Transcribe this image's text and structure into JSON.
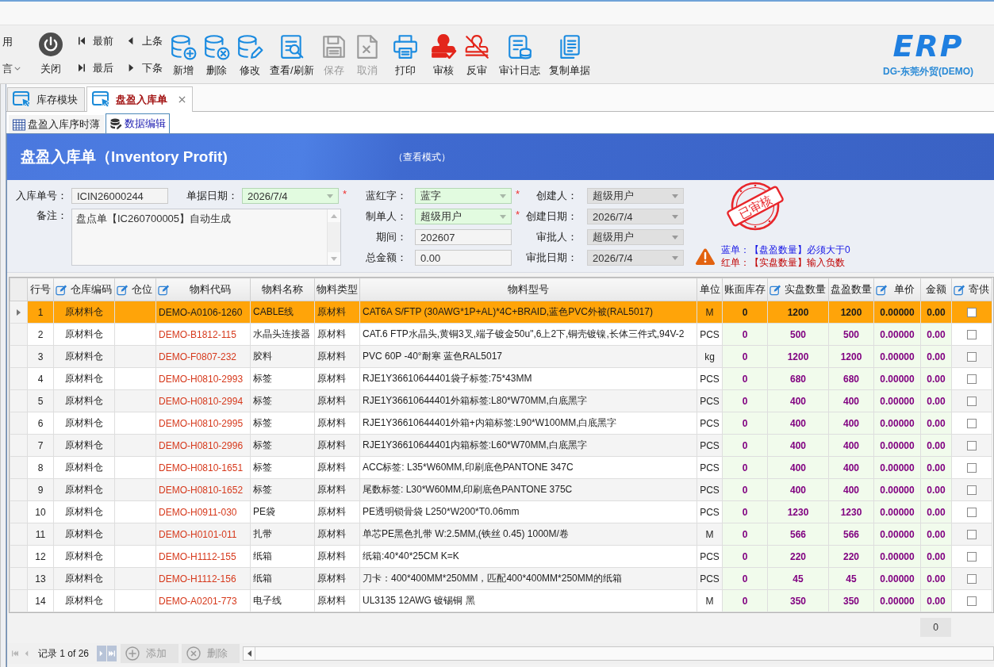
{
  "toolbar": {
    "quick": [
      {
        "label": "用",
        "dropdown": false
      },
      {
        "label": "言",
        "dropdown": true
      }
    ],
    "close": {
      "label": "关闭"
    },
    "nav": [
      {
        "label": "最前",
        "kind": "first"
      },
      {
        "label": "上条",
        "kind": "prev"
      },
      {
        "label": "最后",
        "kind": "last"
      },
      {
        "label": "下条",
        "kind": "next"
      }
    ],
    "actions": [
      {
        "label": "新增",
        "kind": "add",
        "disabled": false
      },
      {
        "label": "删除",
        "kind": "delete",
        "disabled": false
      },
      {
        "label": "修改",
        "kind": "edit",
        "disabled": false
      },
      {
        "label": "查看/刷新",
        "kind": "view",
        "disabled": false
      },
      {
        "label": "保存",
        "kind": "save",
        "disabled": true
      },
      {
        "label": "取消",
        "kind": "cancel",
        "disabled": true
      },
      {
        "label": "打印",
        "kind": "print",
        "disabled": false
      },
      {
        "label": "审核",
        "kind": "approve",
        "disabled": false
      },
      {
        "label": "反审",
        "kind": "unapprove",
        "disabled": false
      },
      {
        "label": "审计日志",
        "kind": "audit",
        "disabled": false
      },
      {
        "label": "复制单据",
        "kind": "copy",
        "disabled": false
      }
    ]
  },
  "logo": {
    "text": "ERP",
    "caption": "DG-东莞外贸(DEMO)"
  },
  "tabs": [
    {
      "label": "库存模块",
      "selected": false,
      "closable": false
    },
    {
      "label": "盘盈入库单",
      "selected": true,
      "closable": true
    }
  ],
  "subtabs": [
    {
      "label": "盘盈入库序时薄",
      "kind": "grid",
      "selected": false
    },
    {
      "label": "数据编辑",
      "kind": "database",
      "selected": true
    }
  ],
  "header": {
    "title": "盘盈入库单（Inventory Profit)",
    "mode": "（查看模式）"
  },
  "form": {
    "head": [
      {
        "label": "入库单号：",
        "value": "ICIN26000244",
        "kind": "text",
        "editable": false,
        "disabled": false
      },
      {
        "label": "单据日期：",
        "value": "2026/7/4",
        "kind": "select",
        "editable": true,
        "disabled": false,
        "mark": "*"
      }
    ],
    "memo": {
      "label": "备注：",
      "value": "盘点单【IC260700005】自动生成"
    },
    "middle": [
      {
        "label": "蓝红字：",
        "value": "蓝字",
        "kind": "select",
        "editable": true,
        "disabled": false,
        "mark": "*"
      },
      {
        "label": "制单人：",
        "value": "超级用户",
        "kind": "select",
        "editable": true,
        "disabled": false,
        "mark": "*"
      },
      {
        "label": "期间：",
        "value": "202607",
        "kind": "text",
        "editable": false,
        "disabled": false
      },
      {
        "label": "总金额：",
        "value": "0.00",
        "kind": "text",
        "editable": false,
        "disabled": false
      }
    ],
    "right": [
      {
        "label": "创建人：",
        "value": "超级用户",
        "kind": "select",
        "editable": false,
        "disabled": true
      },
      {
        "label": "创建日期：",
        "value": "2026/7/4",
        "kind": "select",
        "editable": false,
        "disabled": true
      },
      {
        "label": "审批人：",
        "value": "超级用户",
        "kind": "select",
        "editable": false,
        "disabled": true
      },
      {
        "label": "审批日期：",
        "value": "2026/7/4",
        "kind": "select",
        "editable": false,
        "disabled": true
      }
    ]
  },
  "stamp": {
    "text": "已审核"
  },
  "notes": [
    {
      "text": "蓝单：【盘盈数量】必须大于0",
      "color": "#1414e6"
    },
    {
      "text": "红单：【实盘数量】输入负数",
      "color": "#c00000"
    }
  ],
  "table": {
    "columns": [
      {
        "label": "行号",
        "kind": "index",
        "editable": false
      },
      {
        "label": "仓库编码",
        "kind": "center",
        "editable": true
      },
      {
        "label": "仓位",
        "kind": "center",
        "editable": true
      },
      {
        "label": "物料代码",
        "kind": "code",
        "editable": true
      },
      {
        "label": "物料名称",
        "kind": "text",
        "editable": false
      },
      {
        "label": "物料类型",
        "kind": "text",
        "editable": false
      },
      {
        "label": "物料型号",
        "kind": "text",
        "editable": false
      },
      {
        "label": "单位",
        "kind": "center",
        "editable": false
      },
      {
        "label": "账面库存",
        "kind": "number",
        "editable": false
      },
      {
        "label": "实盘数量",
        "kind": "number",
        "editable": true
      },
      {
        "label": "盘盈数量",
        "kind": "number",
        "editable": false
      },
      {
        "label": "单价",
        "kind": "number",
        "editable": true
      },
      {
        "label": "金额",
        "kind": "number",
        "editable": false
      },
      {
        "label": "寄供",
        "kind": "check",
        "editable": true
      }
    ],
    "rows": [
      {
        "selected": true,
        "row_no": "1",
        "warehouse": "原材料仓",
        "code": "DEMO-A0106-1260",
        "name": "CABLE线",
        "type": "原材料",
        "spec": "CAT6A S/FTP (30AWG*1P+AL)*4C+BRAID,蓝色PVC外被(RAL5017)",
        "unit": "M",
        "book_qty": "0",
        "actual_qty": "1200",
        "profit_qty": "1200",
        "price": "0.00000",
        "amount": "0.00",
        "consign": false
      },
      {
        "selected": false,
        "row_no": "2",
        "warehouse": "原材料仓",
        "code": "DEMO-B1812-115",
        "name": "水晶头连接器",
        "type": "原材料",
        "spec": "CAT.6 FTP水晶头,黄铜3叉,端子镀金50u\",6上2下,铜壳镀镍,长体三件式,94V-2",
        "unit": "PCS",
        "book_qty": "0",
        "actual_qty": "500",
        "profit_qty": "500",
        "price": "0.00000",
        "amount": "0.00",
        "consign": false
      },
      {
        "selected": false,
        "row_no": "3",
        "warehouse": "原材料仓",
        "code": "DEMO-F0807-232",
        "name": "胶料",
        "type": "原材料",
        "spec": "PVC 60P -40°耐寒 蓝色RAL5017",
        "unit": "kg",
        "book_qty": "0",
        "actual_qty": "1200",
        "profit_qty": "1200",
        "price": "0.00000",
        "amount": "0.00",
        "consign": false
      },
      {
        "selected": false,
        "row_no": "4",
        "warehouse": "原材料仓",
        "code": "DEMO-H0810-2993",
        "name": "标签",
        "type": "原材料",
        "spec": "RJE1Y36610644401袋子标签:75*43MM",
        "unit": "PCS",
        "book_qty": "0",
        "actual_qty": "680",
        "profit_qty": "680",
        "price": "0.00000",
        "amount": "0.00",
        "consign": false
      },
      {
        "selected": false,
        "row_no": "5",
        "warehouse": "原材料仓",
        "code": "DEMO-H0810-2994",
        "name": "标签",
        "type": "原材料",
        "spec": "RJE1Y36610644401外箱标签:L80*W70MM,白底黑字",
        "unit": "PCS",
        "book_qty": "0",
        "actual_qty": "400",
        "profit_qty": "400",
        "price": "0.00000",
        "amount": "0.00",
        "consign": false
      },
      {
        "selected": false,
        "row_no": "6",
        "warehouse": "原材料仓",
        "code": "DEMO-H0810-2995",
        "name": "标签",
        "type": "原材料",
        "spec": "RJE1Y36610644401外箱+内箱标签:L90*W100MM,白底黑字",
        "unit": "PCS",
        "book_qty": "0",
        "actual_qty": "400",
        "profit_qty": "400",
        "price": "0.00000",
        "amount": "0.00",
        "consign": false
      },
      {
        "selected": false,
        "row_no": "7",
        "warehouse": "原材料仓",
        "code": "DEMO-H0810-2996",
        "name": "标签",
        "type": "原材料",
        "spec": "RJE1Y36610644401内箱标签:L60*W70MM,白底黑字",
        "unit": "PCS",
        "book_qty": "0",
        "actual_qty": "400",
        "profit_qty": "400",
        "price": "0.00000",
        "amount": "0.00",
        "consign": false
      },
      {
        "selected": false,
        "row_no": "8",
        "warehouse": "原材料仓",
        "code": "DEMO-H0810-1651",
        "name": "标签",
        "type": "原材料",
        "spec": "ACC标签: L35*W60MM,印刷底色PANTONE 347C",
        "unit": "PCS",
        "book_qty": "0",
        "actual_qty": "400",
        "profit_qty": "400",
        "price": "0.00000",
        "amount": "0.00",
        "consign": false
      },
      {
        "selected": false,
        "row_no": "9",
        "warehouse": "原材料仓",
        "code": "DEMO-H0810-1652",
        "name": "标签",
        "type": "原材料",
        "spec": "尾数标签: L30*W60MM,印刷底色PANTONE 375C",
        "unit": "PCS",
        "book_qty": "0",
        "actual_qty": "400",
        "profit_qty": "400",
        "price": "0.00000",
        "amount": "0.00",
        "consign": false
      },
      {
        "selected": false,
        "row_no": "10",
        "warehouse": "原材料仓",
        "code": "DEMO-H0911-030",
        "name": "PE袋",
        "type": "原材料",
        "spec": "PE透明锁骨袋 L250*W200*T0.06mm",
        "unit": "PCS",
        "book_qty": "0",
        "actual_qty": "1230",
        "profit_qty": "1230",
        "price": "0.00000",
        "amount": "0.00",
        "consign": false
      },
      {
        "selected": false,
        "row_no": "11",
        "warehouse": "原材料仓",
        "code": "DEMO-H0101-011",
        "name": "扎带",
        "type": "原材料",
        "spec": "单芯PE黑色扎带 W:2.5MM,(铁丝 0.45) 1000M/卷",
        "unit": "M",
        "book_qty": "0",
        "actual_qty": "566",
        "profit_qty": "566",
        "price": "0.00000",
        "amount": "0.00",
        "consign": false
      },
      {
        "selected": false,
        "row_no": "12",
        "warehouse": "原材料仓",
        "code": "DEMO-H1112-155",
        "name": "纸箱",
        "type": "原材料",
        "spec": "纸箱:40*40*25CM K=K",
        "unit": "PCS",
        "book_qty": "0",
        "actual_qty": "220",
        "profit_qty": "220",
        "price": "0.00000",
        "amount": "0.00",
        "consign": false
      },
      {
        "selected": false,
        "row_no": "13",
        "warehouse": "原材料仓",
        "code": "DEMO-H1112-156",
        "name": "纸箱",
        "type": "原材料",
        "spec": "刀卡：400*400MM*250MM，匹配400*400MM*250MM的纸箱",
        "unit": "PCS",
        "book_qty": "0",
        "actual_qty": "45",
        "profit_qty": "45",
        "price": "0.00000",
        "amount": "0.00",
        "consign": false
      },
      {
        "selected": false,
        "row_no": "14",
        "warehouse": "原材料仓",
        "code": "DEMO-A0201-773",
        "name": "电子线",
        "type": "原材料",
        "spec": "UL3135 12AWG 镀锡铜 黑",
        "unit": "M",
        "book_qty": "0",
        "actual_qty": "350",
        "profit_qty": "350",
        "price": "0.00000",
        "amount": "0.00",
        "consign": false
      }
    ],
    "summary": "0"
  },
  "pager": {
    "record": "记录 1 of 26",
    "nav": [
      {
        "kind": "first",
        "disabled": true
      },
      {
        "kind": "prev",
        "disabled": true
      },
      {
        "kind": "next",
        "disabled": false
      },
      {
        "kind": "last",
        "disabled": false
      }
    ],
    "buttons": [
      {
        "label": "添加",
        "kind": "add",
        "disabled": true
      },
      {
        "label": "删除",
        "kind": "delete",
        "disabled": true
      }
    ]
  }
}
